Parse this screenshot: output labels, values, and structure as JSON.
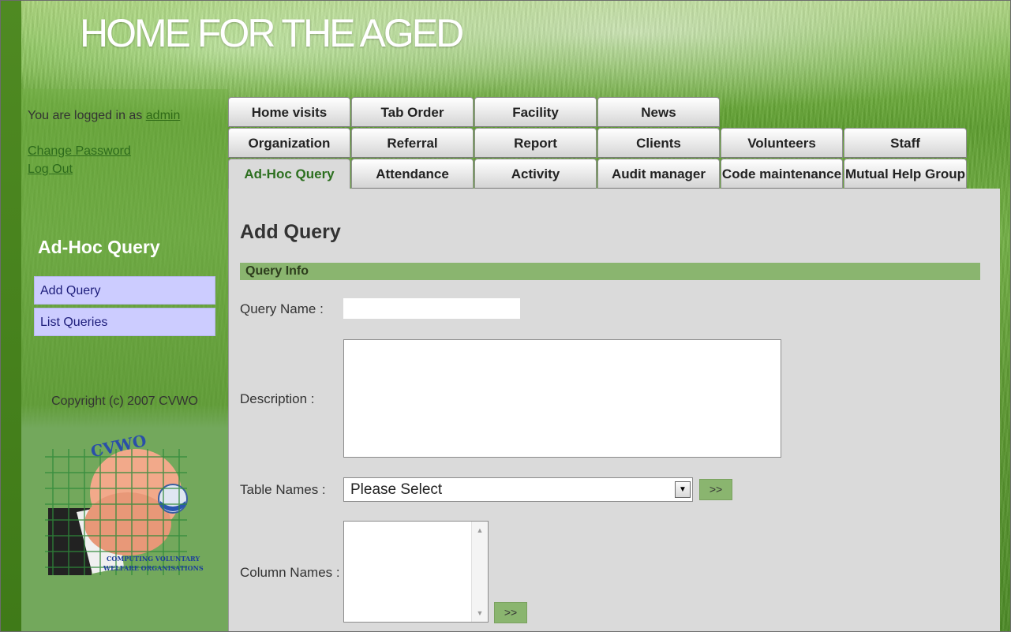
{
  "header": {
    "partial_title": "",
    "site_title": "HOME FOR THE AGED"
  },
  "sidebar": {
    "login_prefix": "You are logged in as",
    "username": "admin",
    "change_password": "Change Password",
    "log_out": "Log Out",
    "section_title": "Ad-Hoc Query",
    "menu": [
      {
        "label": "Add Query"
      },
      {
        "label": "List Queries"
      }
    ],
    "copyright": "Copyright (c) 2007 CVWO",
    "logo_text_top": "CVWO",
    "logo_text_bottom_1": "COMPUTING VOLUNTARY",
    "logo_text_bottom_2": "WELFARE ORGANISATIONS"
  },
  "tabs": {
    "row1": [
      "Home visits",
      "Tab Order",
      "Facility",
      "News"
    ],
    "row2": [
      "Organization",
      "Referral",
      "Report",
      "Clients",
      "Volunteers",
      "Staff"
    ],
    "row3": [
      "Ad-Hoc Query",
      "Attendance",
      "Activity",
      "Audit manager",
      "Code maintenance",
      "Mutual Help Group"
    ],
    "active": "Ad-Hoc Query"
  },
  "main": {
    "page_title": "Add Query",
    "section_bar": "Query Info",
    "query_name_label": "Query Name :",
    "query_name_value": "",
    "description_label": "Description :",
    "description_value": "",
    "table_names_label": "Table Names :",
    "table_names_selected": "Please Select",
    "column_names_label": "Column Names :",
    "add_button_label": ">>"
  },
  "colors": {
    "accent_green": "#8ab56f",
    "menu_bg": "#ccccff",
    "content_bg": "#dadada",
    "active_tab_text": "#2c6f1f"
  }
}
